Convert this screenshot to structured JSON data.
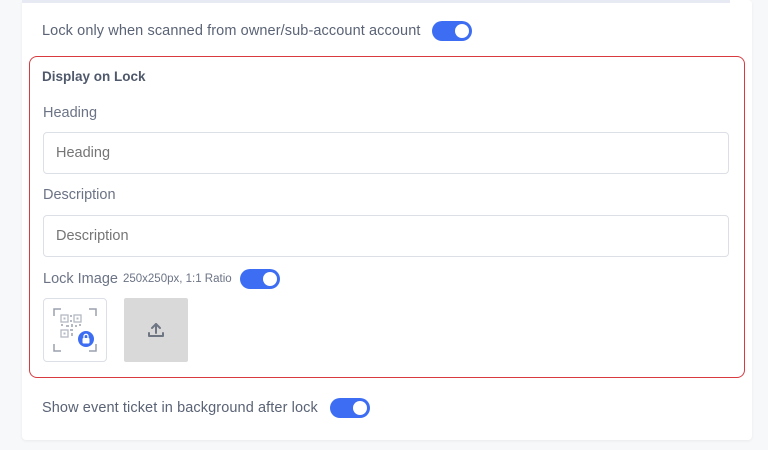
{
  "settings": {
    "lock_owner_label": "Lock only when scanned from owner/sub-account account",
    "lock_owner_enabled": true,
    "show_ticket_label": "Show event ticket in background after lock",
    "show_ticket_enabled": true
  },
  "display_on_lock": {
    "title": "Display on Lock",
    "heading_label": "Heading",
    "heading_placeholder": "Heading",
    "description_label": "Description",
    "description_placeholder": "Description",
    "lock_image_label": "Lock Image",
    "lock_image_hint": "250x250px, 1:1 Ratio",
    "lock_image_enabled": true
  },
  "icons": {
    "thumbnail": "qr-lock-icon",
    "upload": "upload-icon"
  },
  "colors": {
    "accent": "#3d6df2",
    "highlight_border": "#d93a3f"
  }
}
